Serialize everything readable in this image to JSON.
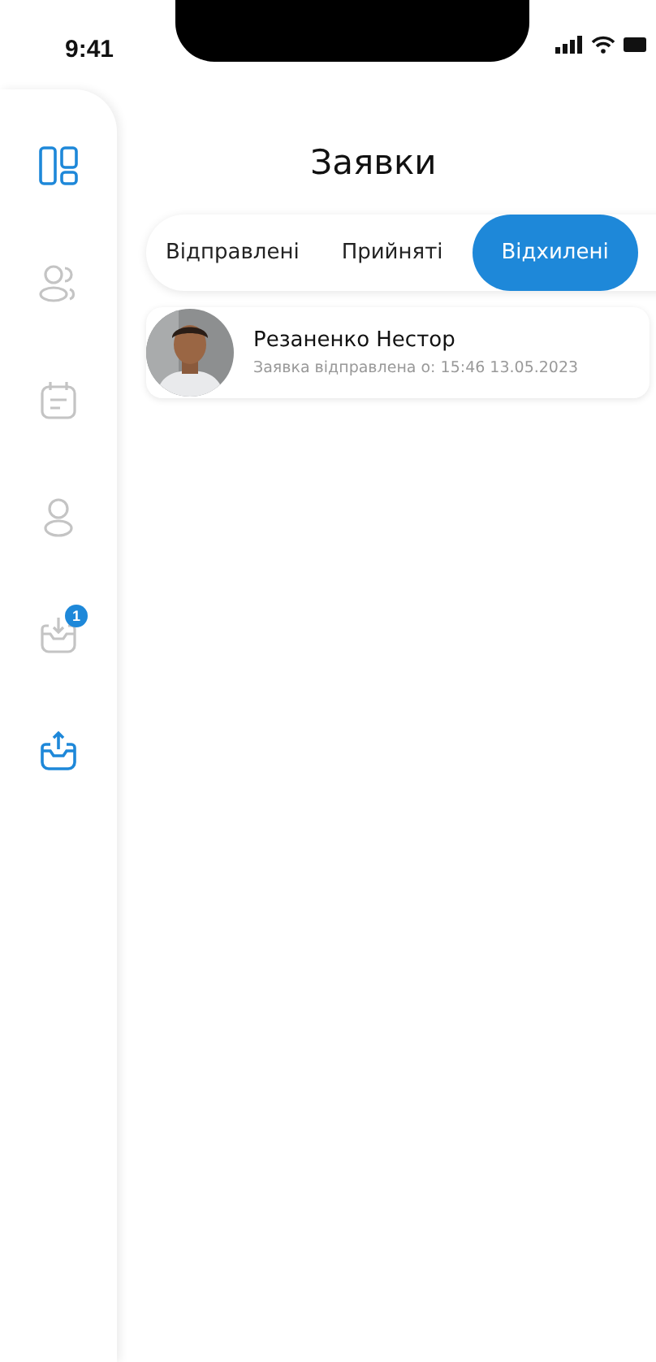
{
  "status_bar": {
    "time": "9:41"
  },
  "sidebar": {
    "items": [
      {
        "kind": "dashboard",
        "selected": true
      },
      {
        "kind": "users",
        "selected": false
      },
      {
        "kind": "calendar",
        "selected": false
      },
      {
        "kind": "user",
        "selected": false
      },
      {
        "kind": "inbox",
        "selected": false,
        "badge": "1"
      },
      {
        "kind": "outbox",
        "selected": true
      }
    ]
  },
  "title": "Заявки",
  "tabs": [
    {
      "label": "Відправлені",
      "selected": false
    },
    {
      "label": "Прийняті",
      "selected": false
    },
    {
      "label": "Відхилені",
      "selected": true
    }
  ],
  "requests": [
    {
      "name": "Резаненко Нестор",
      "subtitle": "Заявка відправлена о: 15:46 13.05.2023"
    }
  ]
}
